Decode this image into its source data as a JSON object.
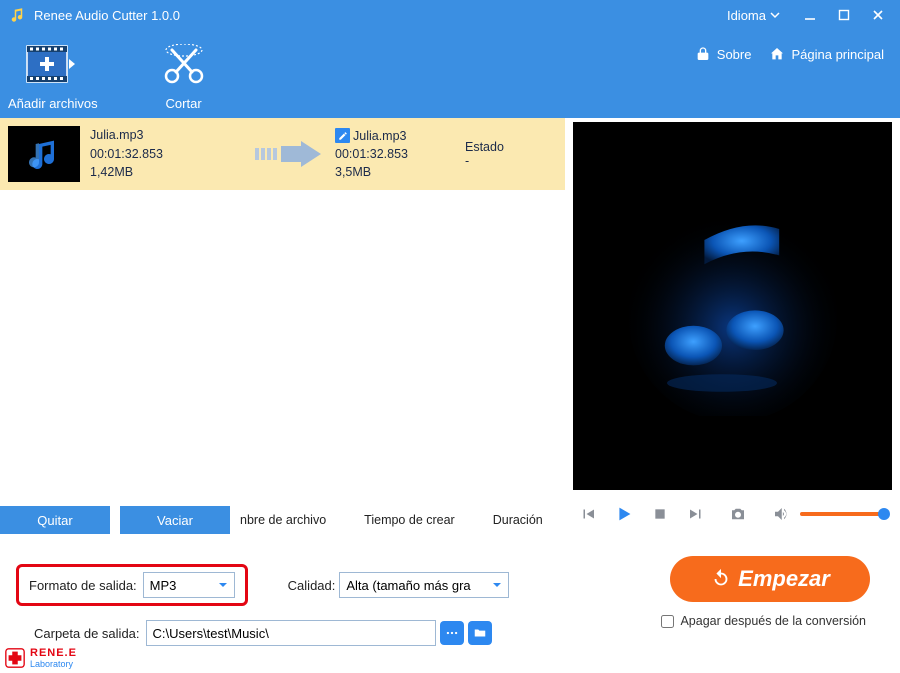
{
  "app": {
    "title": "Renee Audio Cutter 1.0.0"
  },
  "titlebar": {
    "language": "Idioma"
  },
  "toolbar": {
    "add": "Añadir archivos",
    "cut": "Cortar",
    "about": "Sobre",
    "home": "Página principal"
  },
  "file": {
    "in_name": "Julia.mp3",
    "in_time": "00:01:32.853",
    "in_size": "1,42MB",
    "out_name": "Julia.mp3",
    "out_time": "00:01:32.853",
    "out_size": "3,5MB",
    "state_header": "Estado",
    "state_value": "-"
  },
  "list_footer": {
    "remove": "Quitar",
    "clear": "Vaciar",
    "col_name": "nbre de archivo",
    "col_time": "Tiempo de crear",
    "col_duration": "Duración"
  },
  "output": {
    "format_label": "Formato de salida:",
    "format_value": "MP3",
    "quality_label": "Calidad:",
    "quality_value": "Alta (tamaño más gra",
    "folder_label": "Carpeta de salida:",
    "folder_value": "C:\\Users\\test\\Music\\"
  },
  "actions": {
    "start": "Empezar",
    "shutdown": "Apagar después de la conversión"
  },
  "brand": {
    "name": "RENE.E",
    "sub": "Laboratory"
  }
}
